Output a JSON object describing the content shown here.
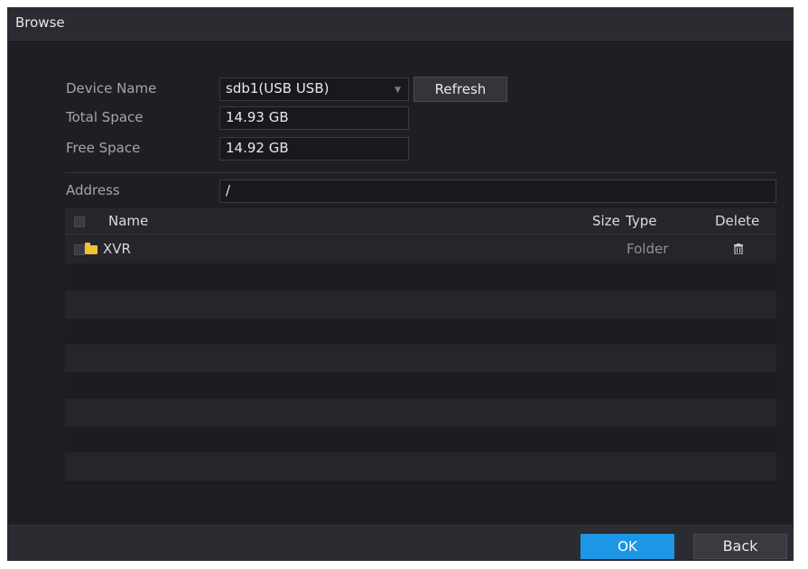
{
  "dialog": {
    "title": "Browse"
  },
  "form": {
    "device_name_label": "Device Name",
    "device_name_value": "sdb1(USB USB)",
    "refresh_label": "Refresh",
    "total_space_label": "Total Space",
    "total_space_value": "14.93 GB",
    "free_space_label": "Free Space",
    "free_space_value": "14.92 GB",
    "address_label": "Address",
    "address_value": "/"
  },
  "table": {
    "headers": {
      "name": "Name",
      "size": "Size",
      "type": "Type",
      "delete": "Delete"
    },
    "rows": [
      {
        "name": "XVR",
        "size": "",
        "type": "Folder"
      }
    ]
  },
  "footer": {
    "ok_label": "OK",
    "back_label": "Back"
  },
  "colors": {
    "accent": "#1e96e6",
    "folder": "#f2c230",
    "background": "#1e1f23"
  }
}
